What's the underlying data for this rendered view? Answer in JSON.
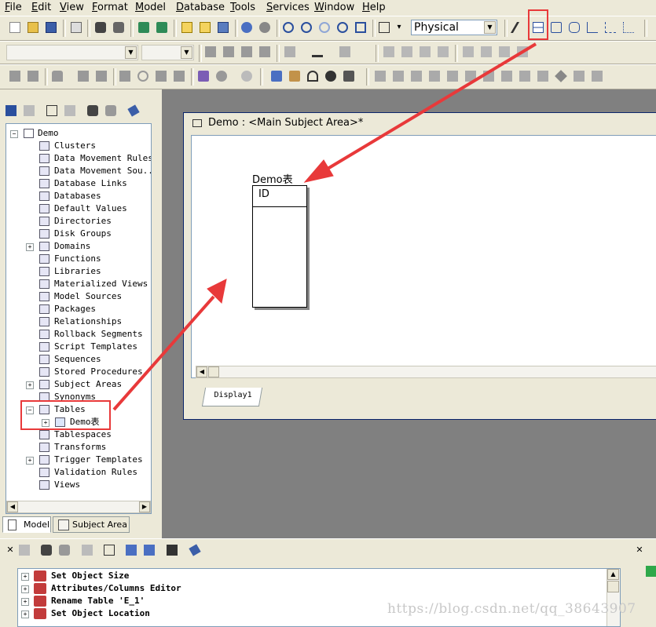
{
  "menu": [
    "File",
    "Edit",
    "View",
    "Format",
    "Model",
    "Database",
    "Tools",
    "Services",
    "Window",
    "Help"
  ],
  "toolbar": {
    "view_mode": "Physical",
    "combo_empty_1": "",
    "combo_empty_2": ""
  },
  "tree": {
    "items": [
      {
        "label": "Demo",
        "icon": "page-icon",
        "expander": "−"
      },
      {
        "label": "Clusters",
        "icon": "cluster-icon"
      },
      {
        "label": "Data Movement Rules",
        "icon": "rule-icon"
      },
      {
        "label": "Data Movement Sou...",
        "icon": "source-icon"
      },
      {
        "label": "Database Links",
        "icon": "link-icon"
      },
      {
        "label": "Databases",
        "icon": "database-icon"
      },
      {
        "label": "Default Values",
        "icon": "value-icon"
      },
      {
        "label": "Directories",
        "icon": "directory-icon"
      },
      {
        "label": "Disk Groups",
        "icon": "disk-icon"
      },
      {
        "label": "Domains",
        "icon": "domain-icon",
        "expander": "+"
      },
      {
        "label": "Functions",
        "icon": "function-icon"
      },
      {
        "label": "Libraries",
        "icon": "library-icon"
      },
      {
        "label": "Materialized Views",
        "icon": "view-icon"
      },
      {
        "label": "Model Sources",
        "icon": "model-source-icon"
      },
      {
        "label": "Packages",
        "icon": "package-icon"
      },
      {
        "label": "Relationships",
        "icon": "relationship-icon"
      },
      {
        "label": "Rollback Segments",
        "icon": "rollback-icon"
      },
      {
        "label": "Script Templates",
        "icon": "script-icon"
      },
      {
        "label": "Sequences",
        "icon": "sequence-icon"
      },
      {
        "label": "Stored Procedures",
        "icon": "procedure-icon"
      },
      {
        "label": "Subject Areas",
        "icon": "subject-area-icon",
        "expander": "+"
      },
      {
        "label": "Synonyms",
        "icon": "synonym-icon"
      },
      {
        "label": "Tables",
        "icon": "tables-icon",
        "expander": "−"
      },
      {
        "label": "Demo表",
        "icon": "table-icon",
        "expander": "+",
        "indent": 1
      },
      {
        "label": "Tablespaces",
        "icon": "tablespace-icon"
      },
      {
        "label": "Transforms",
        "icon": "transform-icon"
      },
      {
        "label": "Trigger Templates",
        "icon": "trigger-icon",
        "expander": "+"
      },
      {
        "label": "Validation Rules",
        "icon": "validation-icon"
      },
      {
        "label": "Views",
        "icon": "views-icon"
      }
    ]
  },
  "tabs": {
    "model": "Model",
    "subject_area": "Subject Area"
  },
  "diagram": {
    "title": "Demo : <Main Subject Area>*",
    "entity_name": "Demo表",
    "entity_column": "ID",
    "display_tab": "Display1"
  },
  "output": {
    "items": [
      "Set Object Size",
      "Attributes/Columns Editor",
      "Rename Table 'E_1'",
      "Set Object Location"
    ]
  },
  "watermark": "https://blog.csdn.net/qq_38643907",
  "colors": {
    "highlight_red": "#e8393a",
    "canvas_bg": "#808080",
    "panel": "#ece9d8"
  }
}
